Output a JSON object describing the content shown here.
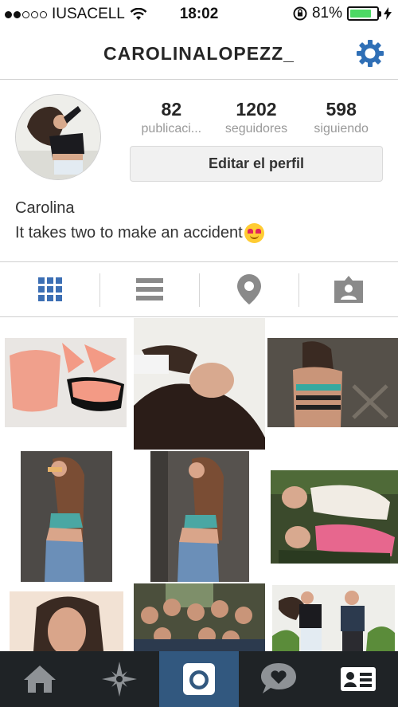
{
  "status_bar": {
    "carrier": "IUSACELL",
    "time": "18:02",
    "battery_percent": "81%",
    "battery_level": 0.81,
    "signal_bars_filled": 2,
    "signal_bars_total": 5
  },
  "header": {
    "username": "CAROLINALOPEZZ_"
  },
  "profile": {
    "stats": [
      {
        "value": "82",
        "label": "publicaci..."
      },
      {
        "value": "1202",
        "label": "seguidores"
      },
      {
        "value": "598",
        "label": "siguiendo"
      }
    ],
    "edit_button_label": "Editar el perfil",
    "full_name": "Carolina",
    "bio": "It takes two to make an accident"
  },
  "view_tabs": [
    {
      "icon": "grid-icon",
      "active": true
    },
    {
      "icon": "list-icon",
      "active": false
    },
    {
      "icon": "location-pin-icon",
      "active": false
    },
    {
      "icon": "tagged-person-icon",
      "active": false
    }
  ],
  "bottom_nav": [
    {
      "icon": "home-icon",
      "active": false
    },
    {
      "icon": "explore-star-icon",
      "active": false
    },
    {
      "icon": "camera-icon",
      "active": true
    },
    {
      "icon": "activity-bubble-icon",
      "active": false
    },
    {
      "icon": "profile-card-icon",
      "active": false
    }
  ],
  "colors": {
    "accent_blue": "#3c6fb4",
    "settings_blue": "#2f6fb6",
    "battery_green": "#4cd964",
    "nav_background": "#1f2326",
    "nav_active": "#32587f"
  }
}
